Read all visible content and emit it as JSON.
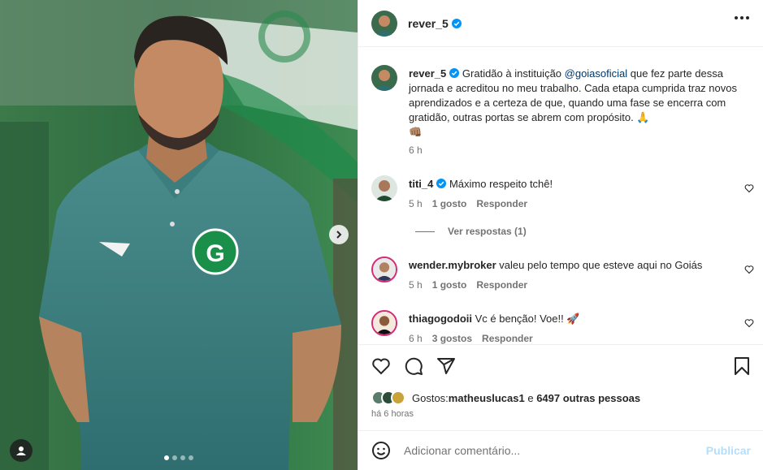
{
  "post": {
    "author": "rever_5",
    "verified_color": "#0095f6",
    "caption_prefix": "Gratidão à instituição ",
    "caption_mention": "@goiasoficial",
    "caption_suffix": " que fez parte dessa jornada e acreditou no meu trabalho. Cada etapa cumprida traz novos aprendizados e a certeza de que, quando uma fase se encerra com gratidão, outras portas se abrem com propósito. 🙏",
    "caption_tail": "👊🏽",
    "caption_time": "6 h"
  },
  "comments": [
    {
      "user": "titi_4",
      "verified": true,
      "text": "Máximo respeito tchê!",
      "time": "5 h",
      "likes": "1 gosto",
      "reply": "Responder"
    },
    {
      "user": "wender.mybroker",
      "verified": false,
      "text": "valeu pelo tempo que esteve aqui no Goiás",
      "time": "5 h",
      "likes": "1 gosto",
      "reply": "Responder"
    },
    {
      "user": "thiagogodoii",
      "verified": false,
      "text": "Vc é benção! Voe!! 🚀",
      "time": "6 h",
      "likes": "3 gostos",
      "reply": "Responder"
    }
  ],
  "view_replies": "Ver respostas (1)",
  "likes": {
    "prefix": "Gostos: ",
    "user": "matheuslucas1",
    "middle": " e ",
    "others": "6497 outras pessoas"
  },
  "post_time": "há 6 horas",
  "add_comment": {
    "placeholder": "Adicionar comentário...",
    "publish": "Publicar"
  },
  "icons": {
    "like": "heart-icon",
    "comment": "comment-icon",
    "share": "share-icon",
    "save": "bookmark-icon",
    "more": "more-icon",
    "next": "chevron-right-icon",
    "tag": "user-tag-icon",
    "emoji": "emoji-icon"
  },
  "carousel": {
    "count": 4,
    "active": 1
  }
}
